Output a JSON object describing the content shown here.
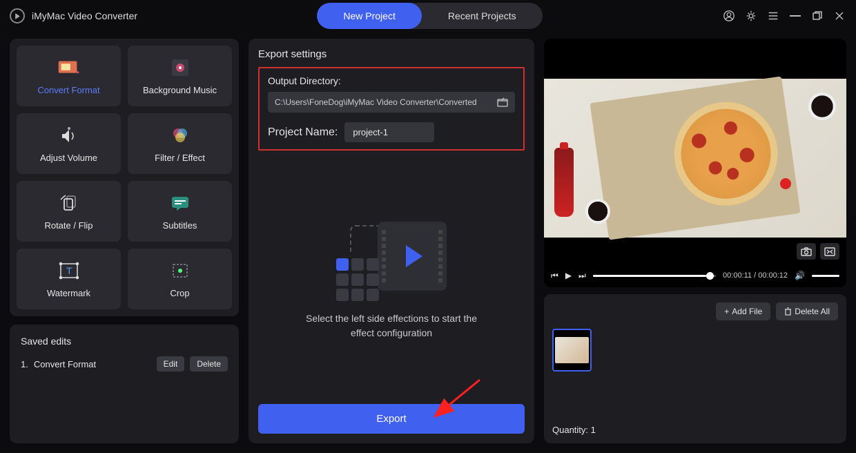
{
  "app_title": "iMyMac Video Converter",
  "tabs": {
    "new_project": "New Project",
    "recent_projects": "Recent Projects"
  },
  "effects": [
    {
      "name": "convert-format",
      "label": "Convert Format"
    },
    {
      "name": "background-music",
      "label": "Background Music"
    },
    {
      "name": "adjust-volume",
      "label": "Adjust Volume"
    },
    {
      "name": "filter-effect",
      "label": "Filter / Effect"
    },
    {
      "name": "rotate-flip",
      "label": "Rotate / Flip"
    },
    {
      "name": "subtitles",
      "label": "Subtitles"
    },
    {
      "name": "watermark",
      "label": "Watermark"
    },
    {
      "name": "crop",
      "label": "Crop"
    }
  ],
  "saved": {
    "title": "Saved edits",
    "items": [
      {
        "num": "1.",
        "name": "Convert Format"
      }
    ],
    "edit": "Edit",
    "delete": "Delete"
  },
  "export": {
    "title": "Export settings",
    "out_dir_label": "Output Directory:",
    "out_dir_path": "C:\\Users\\FoneDog\\iMyMac Video Converter\\Converted",
    "project_name_label": "Project Name:",
    "project_name_value": "project-1",
    "helper_text1": "Select the left side effections to start the",
    "helper_text2": "effect configuration",
    "button": "Export"
  },
  "preview": {
    "time_current": "00:00:11",
    "time_total": "00:00:12"
  },
  "files": {
    "add_file": "Add File",
    "delete_all": "Delete All",
    "quantity_label": "Quantity:",
    "quantity_value": "1"
  }
}
